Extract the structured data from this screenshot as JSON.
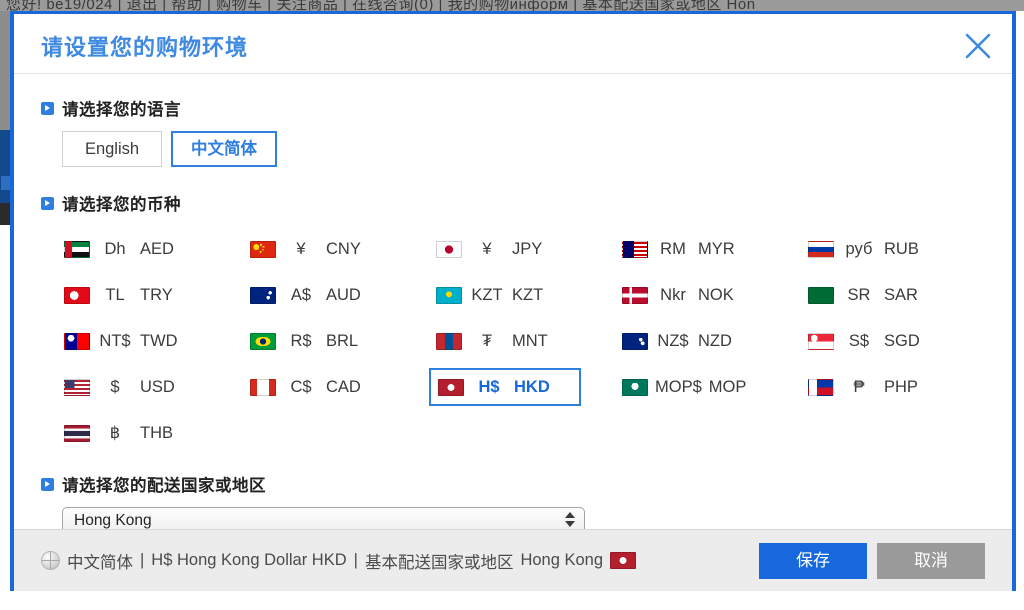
{
  "background": {
    "navbar_text": "您好! be19/024  |  退出  |  帮助  |  购物车  |  关注商品  |  在线咨询(0)  |  我的购物информ  |  基本配送国家或地区 Hon"
  },
  "dialog": {
    "title": "请设置您的购物环境",
    "close_icon": "close-icon"
  },
  "language_section": {
    "heading": "请选择您的语言",
    "options": [
      {
        "label": "English",
        "selected": false
      },
      {
        "label": "中文简体",
        "selected": true
      }
    ]
  },
  "currency_section": {
    "heading": "请选择您的币种",
    "options": [
      {
        "flag": "ae",
        "symbol": "Dh",
        "code": "AED",
        "selected": false
      },
      {
        "flag": "cn",
        "symbol": "¥",
        "code": "CNY",
        "selected": false
      },
      {
        "flag": "jp",
        "symbol": "¥",
        "code": "JPY",
        "selected": false
      },
      {
        "flag": "my",
        "symbol": "RM",
        "code": "MYR",
        "selected": false
      },
      {
        "flag": "ru",
        "symbol": "руб",
        "code": "RUB",
        "selected": false
      },
      {
        "flag": "tr",
        "symbol": "TL",
        "code": "TRY",
        "selected": false
      },
      {
        "flag": "au",
        "symbol": "A$",
        "code": "AUD",
        "selected": false
      },
      {
        "flag": "kz",
        "symbol": "KZT",
        "code": "KZT",
        "selected": false
      },
      {
        "flag": "no",
        "symbol": "Nkr",
        "code": "NOK",
        "selected": false
      },
      {
        "flag": "sa",
        "symbol": "SR",
        "code": "SAR",
        "selected": false
      },
      {
        "flag": "tw",
        "symbol": "NT$",
        "code": "TWD",
        "selected": false
      },
      {
        "flag": "br",
        "symbol": "R$",
        "code": "BRL",
        "selected": false
      },
      {
        "flag": "mn",
        "symbol": "₮",
        "code": "MNT",
        "selected": false
      },
      {
        "flag": "nz",
        "symbol": "NZ$",
        "code": "NZD",
        "selected": false
      },
      {
        "flag": "sg",
        "symbol": "S$",
        "code": "SGD",
        "selected": false
      },
      {
        "flag": "us",
        "symbol": "$",
        "code": "USD",
        "selected": false
      },
      {
        "flag": "ca",
        "symbol": "C$",
        "code": "CAD",
        "selected": false
      },
      {
        "flag": "hk",
        "symbol": "H$",
        "code": "HKD",
        "selected": true
      },
      {
        "flag": "mo",
        "symbol": "MOP$",
        "code": "MOP",
        "selected": false
      },
      {
        "flag": "ph",
        "symbol": "₱",
        "code": "PHP",
        "selected": false
      },
      {
        "flag": "th",
        "symbol": "฿",
        "code": "THB",
        "selected": false
      }
    ]
  },
  "shipping_section": {
    "heading": "请选择您的配送国家或地区",
    "selected_country": "Hong Kong"
  },
  "footer": {
    "globe_icon": "globe-icon",
    "summary_language": "中文简体",
    "sep1": "|",
    "summary_currency": "H$ Hong Kong Dollar HKD",
    "sep2": "|",
    "summary_shipping_label": "基本配送国家或地区",
    "summary_shipping_value": "Hong Kong",
    "summary_flag": "hk",
    "save_label": "保存",
    "cancel_label": "取消"
  },
  "colors": {
    "accent": "#1668dc",
    "title": "#3f8ae0",
    "cancel": "#9a9a9a",
    "footer_bg": "#ececec"
  }
}
